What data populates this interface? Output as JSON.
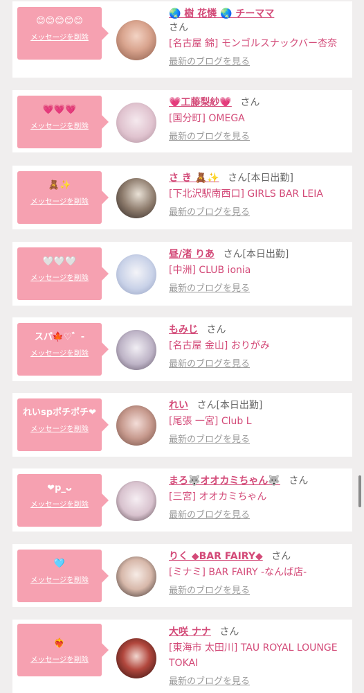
{
  "delete_label": "メッセージを削除",
  "blog_label": "最新のブログを見る",
  "accent_colors": {
    "bubble": "#f6a1b1",
    "name": "#d34a78"
  },
  "cards": [
    {
      "message": "😊😊😊😊😊",
      "name": "🌏 樹 花憐 🌏 チーママ",
      "suffix": "さん",
      "shop": "[名古屋 錦] モンゴルスナックバー杏奈"
    },
    {
      "message": "💗💗💗",
      "name": "💗工藤梨紗💗",
      "suffix": "さん",
      "shop": "[国分町] OMEGA"
    },
    {
      "message": "🧸✨",
      "name": "さ き 🧸✨",
      "suffix": "さん[本日出勤]",
      "shop": "[下北沢駅南西口] GIRLS BAR LEIA"
    },
    {
      "message": "🤍🤍🤍",
      "name": "昼/渚 りあ",
      "suffix": "さん[本日出勤]",
      "shop": "[中洲] CLUB ionia"
    },
    {
      "message": "スパ🍁♡゛-",
      "name": "もみじ",
      "suffix": "さん",
      "shop": "[名古屋 金山] おりがみ"
    },
    {
      "message": "れいspポチポチ❤",
      "name": "れい",
      "suffix": "さん[本日出勤]",
      "shop": "[尾張 一宮] Club L"
    },
    {
      "message": "❤p_ᴗ",
      "name": "まろ🐺オオカミちゃん🐺",
      "suffix": "さん",
      "shop": "[三宮] オオカミちゃん"
    },
    {
      "message": "🩵",
      "name": "りく ◆BAR FAIRY◆",
      "suffix": "さん",
      "shop": "[ミナミ] BAR FAIRY -なんば店-"
    },
    {
      "message": "❤️‍🔥",
      "name": "大咲 ナナ",
      "suffix": "さん",
      "shop": "[東海市 太田川] TAU ROYAL LOUNGE TOKAI"
    }
  ]
}
